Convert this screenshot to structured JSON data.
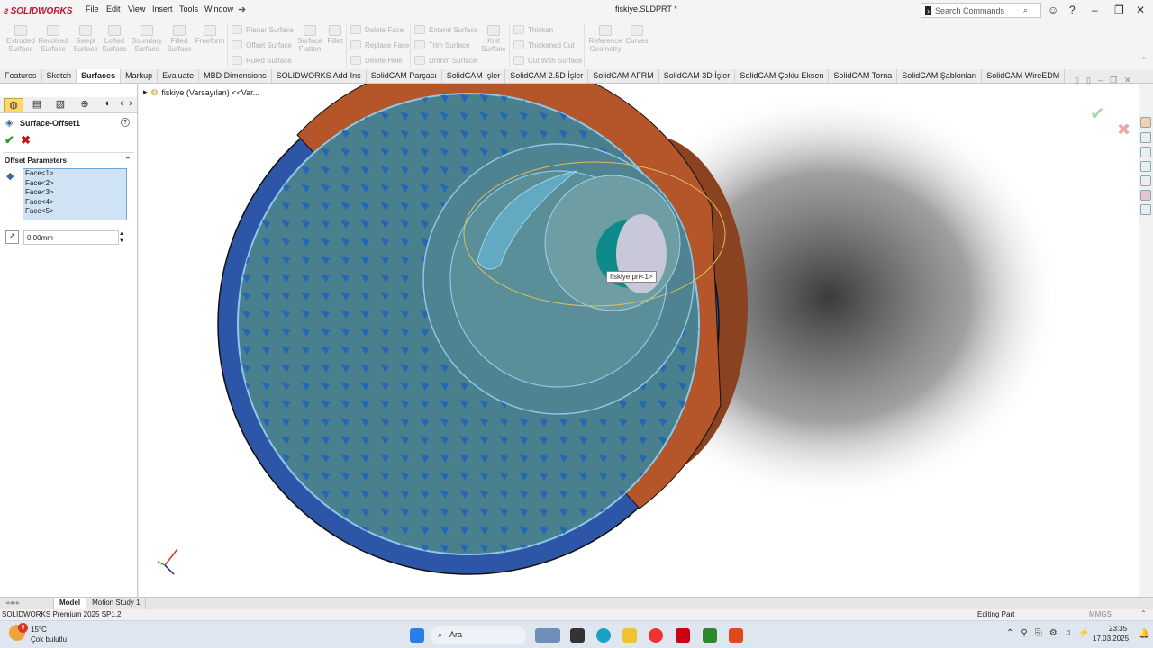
{
  "app": {
    "logo": "SOLIDWORKS",
    "title": "fiskiye.SLDPRT *",
    "menu": [
      "File",
      "Edit",
      "View",
      "Insert",
      "Tools",
      "Window"
    ],
    "search_placeholder": "Search Commands"
  },
  "ribbon": {
    "big_buttons": [
      {
        "label": "Extruded\nSurface"
      },
      {
        "label": "Revolved\nSurface"
      },
      {
        "label": "Swept\nSurface"
      },
      {
        "label": "Lofted\nSurface"
      },
      {
        "label": "Boundary\nSurface"
      },
      {
        "label": "Filled\nSurface"
      },
      {
        "label": "Freeform"
      }
    ],
    "col1": [
      "Planar Surface",
      "Offset Surface",
      "Ruled Surface"
    ],
    "mid": [
      "Surface\nFlatten",
      "Fillet"
    ],
    "col2": [
      "Delete Face",
      "Replace Face",
      "Delete Hole"
    ],
    "col3": [
      "Extend Surface",
      "Trim Surface",
      "Untrim Surface"
    ],
    "knit": "Knit\nSurface",
    "col4": [
      "Thicken",
      "Thickened Cut",
      "Cut With Surface"
    ],
    "ref": "Reference\nGeometry",
    "curves": "Curves"
  },
  "tabs": [
    "Features",
    "Sketch",
    "Surfaces",
    "Markup",
    "Evaluate",
    "MBD Dimensions",
    "SOLIDWORKS Add-Ins",
    "SolidCAM Parçası",
    "SolidCAM İşler",
    "SolidCAM 2.5D İşler",
    "SolidCAM AFRM",
    "SolidCAM 3D İşler",
    "SolidCAM Çoklu Eksen",
    "SolidCAM Torna",
    "SolidCAM Şablonları",
    "SolidCAM WireEDM"
  ],
  "active_tab": "Surfaces",
  "panel": {
    "feature_name": "Surface-Offset1",
    "group_title": "Offset Parameters",
    "faces": [
      "Face<1>",
      "Face<2>",
      "Face<3>",
      "Face<4>",
      "Face<5>"
    ],
    "distance": "0.00mm"
  },
  "viewport": {
    "tree_label": "fiskiye (Varsayılan) <<Var...",
    "tooltip": "fiskiye.prt<1>"
  },
  "bottom_tabs": [
    "Model",
    "Motion Study 1"
  ],
  "status": {
    "left": "SOLIDWORKS Premium 2025 SP1.2",
    "middle": "Editing Part",
    "units": "MMGS"
  },
  "taskbar": {
    "weather_temp": "15°C",
    "weather_desc": "Çok bulutlu",
    "weather_badge": "9",
    "search_label": "Ara",
    "time": "23:35",
    "date": "17.03.2025"
  },
  "colors": {
    "accent": "#c8102e",
    "face_select": "#cfe3f4",
    "cone_blue": "#2d55a8",
    "rim_orange": "#b4552a"
  }
}
